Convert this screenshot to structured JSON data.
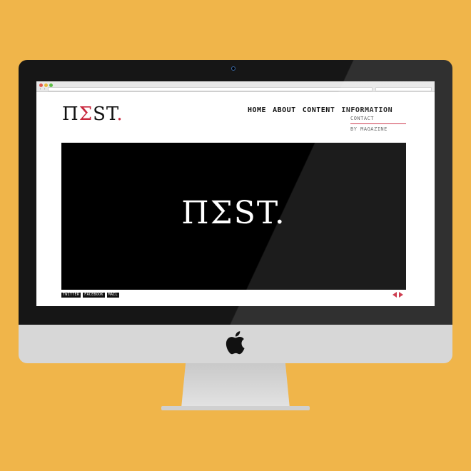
{
  "site": {
    "logo": {
      "pi": "Π",
      "sigma": "Σ",
      "rest": "ST",
      "period": "."
    },
    "nav": [
      "HOME",
      "ABOUT",
      "CONTENT",
      "INFORMATION"
    ],
    "subnav": [
      "CONTACT",
      "BY MAGAZINE"
    ],
    "hero_title": "ΠΣST.",
    "social": [
      "TWITTER",
      "FACEBOOK",
      "MAIL"
    ]
  },
  "colors": {
    "background": "#f0b54a",
    "accent": "#c8263c",
    "hero": "#000000"
  },
  "icons": {
    "prev": "triangle-left",
    "next": "triangle-right",
    "brand": "apple-logo"
  }
}
